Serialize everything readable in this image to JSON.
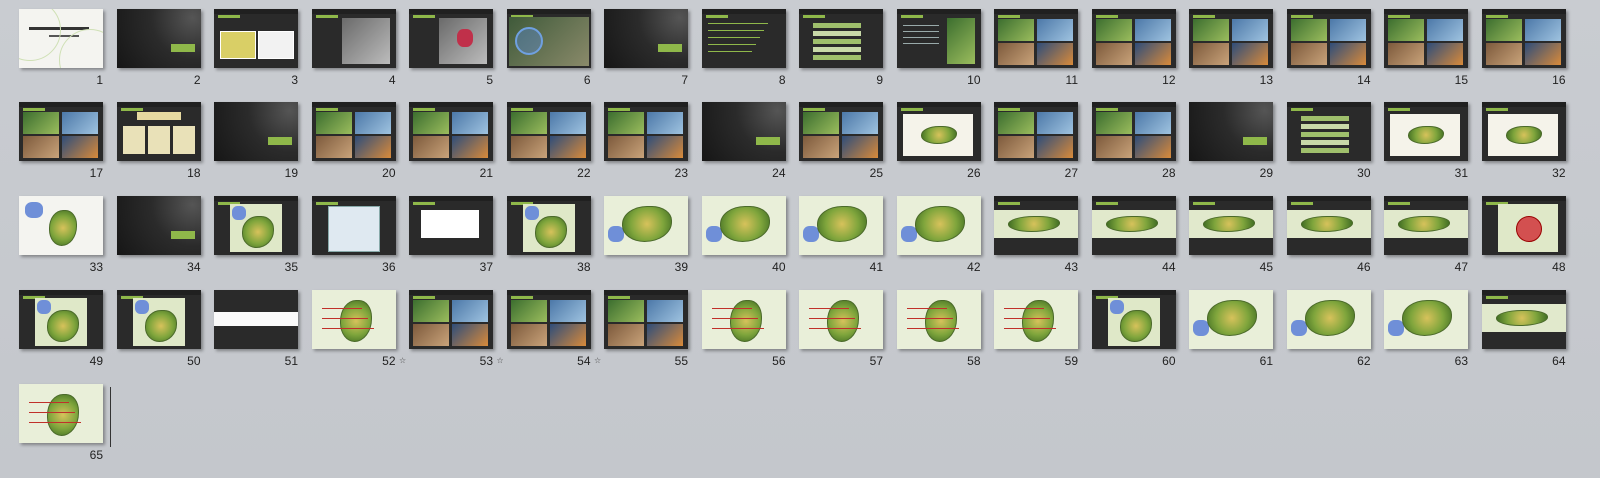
{
  "sorter": {
    "slides": [
      {
        "num": "1",
        "theme": "cover"
      },
      {
        "num": "2",
        "theme": "section"
      },
      {
        "num": "3",
        "theme": "map-pair"
      },
      {
        "num": "4",
        "theme": "map-gray"
      },
      {
        "num": "5",
        "theme": "map-red"
      },
      {
        "num": "6",
        "theme": "aerial"
      },
      {
        "num": "7",
        "theme": "section"
      },
      {
        "num": "8",
        "theme": "text"
      },
      {
        "num": "9",
        "theme": "list"
      },
      {
        "num": "10",
        "theme": "text-photo"
      },
      {
        "num": "11",
        "theme": "photos"
      },
      {
        "num": "12",
        "theme": "photos"
      },
      {
        "num": "13",
        "theme": "photos"
      },
      {
        "num": "14",
        "theme": "photos"
      },
      {
        "num": "15",
        "theme": "photos"
      },
      {
        "num": "16",
        "theme": "photos"
      },
      {
        "num": "17",
        "theme": "photos"
      },
      {
        "num": "18",
        "theme": "diagram"
      },
      {
        "num": "19",
        "theme": "section"
      },
      {
        "num": "20",
        "theme": "photos"
      },
      {
        "num": "21",
        "theme": "photos"
      },
      {
        "num": "22",
        "theme": "photos"
      },
      {
        "num": "23",
        "theme": "photos"
      },
      {
        "num": "24",
        "theme": "section"
      },
      {
        "num": "25",
        "theme": "photos"
      },
      {
        "num": "26",
        "theme": "sketch"
      },
      {
        "num": "27",
        "theme": "photos"
      },
      {
        "num": "28",
        "theme": "photos"
      },
      {
        "num": "29",
        "theme": "section"
      },
      {
        "num": "30",
        "theme": "list"
      },
      {
        "num": "31",
        "theme": "sketch"
      },
      {
        "num": "32",
        "theme": "sketch"
      },
      {
        "num": "33",
        "theme": "plan-white"
      },
      {
        "num": "34",
        "theme": "section"
      },
      {
        "num": "35",
        "theme": "plan-dark"
      },
      {
        "num": "36",
        "theme": "table"
      },
      {
        "num": "37",
        "theme": "table-white"
      },
      {
        "num": "38",
        "theme": "plan-dark"
      },
      {
        "num": "39",
        "theme": "plan"
      },
      {
        "num": "40",
        "theme": "plan"
      },
      {
        "num": "41",
        "theme": "plan"
      },
      {
        "num": "42",
        "theme": "plan"
      },
      {
        "num": "43",
        "theme": "plan-strip"
      },
      {
        "num": "44",
        "theme": "plan-strip"
      },
      {
        "num": "45",
        "theme": "plan-strip"
      },
      {
        "num": "46",
        "theme": "plan-strip"
      },
      {
        "num": "47",
        "theme": "plan-strip"
      },
      {
        "num": "48",
        "theme": "plan-red"
      },
      {
        "num": "49",
        "theme": "plan-dark"
      },
      {
        "num": "50",
        "theme": "plan-dark"
      },
      {
        "num": "51",
        "theme": "section-line"
      },
      {
        "num": "52",
        "theme": "plan-lines"
      },
      {
        "num": "53",
        "theme": "photos",
        "anim": true
      },
      {
        "num": "54",
        "theme": "photos",
        "anim": true
      },
      {
        "num": "55",
        "theme": "photos",
        "anim": true
      },
      {
        "num": "56",
        "theme": "plan-lines"
      },
      {
        "num": "57",
        "theme": "plan-lines"
      },
      {
        "num": "58",
        "theme": "plan-lines"
      },
      {
        "num": "59",
        "theme": "plan-lines"
      },
      {
        "num": "60",
        "theme": "plan-dark"
      },
      {
        "num": "61",
        "theme": "plan"
      },
      {
        "num": "62",
        "theme": "plan"
      },
      {
        "num": "63",
        "theme": "plan"
      },
      {
        "num": "64",
        "theme": "plan-strip"
      },
      {
        "num": "65",
        "theme": "plan-lines"
      }
    ],
    "anim_icon": "☆"
  },
  "colors": {
    "background": "#c6c9ce",
    "accent_green": "#8fb84a",
    "slide_dark": "#2a2a2a"
  }
}
